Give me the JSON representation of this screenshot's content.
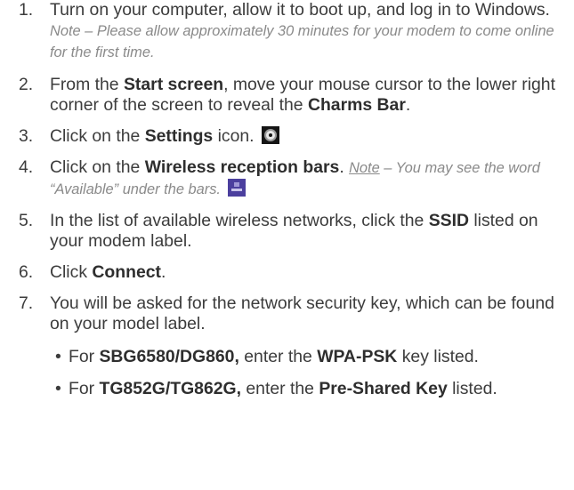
{
  "steps": [
    {
      "num": "1.",
      "parts": [
        {
          "t": "Turn on your computer, allow it to boot up, and log in to Windows. ",
          "s": "n"
        },
        {
          "t": "Note – Please allow approximately 30 minutes for your modem to come online for the first time.",
          "s": "note"
        }
      ]
    },
    {
      "num": "2.",
      "parts": [
        {
          "t": "From the ",
          "s": "n"
        },
        {
          "t": "Start screen",
          "s": "b"
        },
        {
          "t": ", move your mouse cursor to the lower right corner of the screen to reveal the ",
          "s": "n"
        },
        {
          "t": "Charms Bar",
          "s": "b"
        },
        {
          "t": ".",
          "s": "n"
        }
      ]
    },
    {
      "num": "3.",
      "parts": [
        {
          "t": "Click on the ",
          "s": "n"
        },
        {
          "t": "Settings",
          "s": "b"
        },
        {
          "t": " icon.",
          "s": "n"
        }
      ],
      "icon": "settings-gear-icon"
    },
    {
      "num": "4.",
      "parts": [
        {
          "t": "Click on the ",
          "s": "n"
        },
        {
          "t": "Wireless reception bars",
          "s": "b"
        },
        {
          "t": ". ",
          "s": "n"
        },
        {
          "t": "Note",
          "s": "note-u"
        },
        {
          "t": " – You may see the word “Available” under the bars.",
          "s": "note"
        }
      ],
      "icon": "wireless-bars-icon"
    },
    {
      "num": "5.",
      "parts": [
        {
          "t": "In the list of available wireless networks, click the ",
          "s": "n"
        },
        {
          "t": "SSID",
          "s": "b"
        },
        {
          "t": " listed on your modem label.",
          "s": "n"
        }
      ]
    },
    {
      "num": "6.",
      "parts": [
        {
          "t": "Click ",
          "s": "n"
        },
        {
          "t": "Connect",
          "s": "b"
        },
        {
          "t": ".",
          "s": "n"
        }
      ]
    },
    {
      "num": "7.",
      "parts": [
        {
          "t": "You will be asked for the network security key, which can be found on your model label.",
          "s": "n"
        }
      ],
      "sub": [
        [
          {
            "t": "For ",
            "s": "n"
          },
          {
            "t": "SBG6580/DG860,",
            "s": "b"
          },
          {
            "t": " enter the ",
            "s": "n"
          },
          {
            "t": "WPA-PSK",
            "s": "b"
          },
          {
            "t": " key listed.",
            "s": "n"
          }
        ],
        [
          {
            "t": "For ",
            "s": "n"
          },
          {
            "t": "TG852G/TG862G,",
            "s": "b"
          },
          {
            "t": " enter the ",
            "s": "n"
          },
          {
            "t": "Pre-Shared Key",
            "s": "b"
          },
          {
            "t": " listed.",
            "s": "n"
          }
        ]
      ]
    }
  ],
  "bullet": "•",
  "colors": {
    "text": "#3c3c3c",
    "note": "#8a8a8a",
    "settings_icon_bg": "#151515",
    "wireless_icon_bg": "#4b3f9e"
  }
}
